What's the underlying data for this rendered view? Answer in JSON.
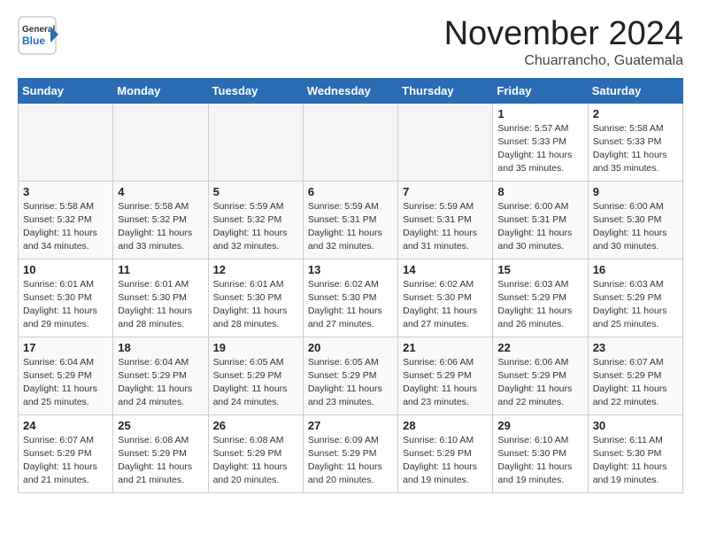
{
  "header": {
    "logo_line1": "General",
    "logo_line2": "Blue",
    "month_title": "November 2024",
    "location": "Chuarrancho, Guatemala"
  },
  "weekdays": [
    "Sunday",
    "Monday",
    "Tuesday",
    "Wednesday",
    "Thursday",
    "Friday",
    "Saturday"
  ],
  "weeks": [
    [
      {
        "day": "",
        "info": ""
      },
      {
        "day": "",
        "info": ""
      },
      {
        "day": "",
        "info": ""
      },
      {
        "day": "",
        "info": ""
      },
      {
        "day": "",
        "info": ""
      },
      {
        "day": "1",
        "info": "Sunrise: 5:57 AM\nSunset: 5:33 PM\nDaylight: 11 hours\nand 35 minutes."
      },
      {
        "day": "2",
        "info": "Sunrise: 5:58 AM\nSunset: 5:33 PM\nDaylight: 11 hours\nand 35 minutes."
      }
    ],
    [
      {
        "day": "3",
        "info": "Sunrise: 5:58 AM\nSunset: 5:32 PM\nDaylight: 11 hours\nand 34 minutes."
      },
      {
        "day": "4",
        "info": "Sunrise: 5:58 AM\nSunset: 5:32 PM\nDaylight: 11 hours\nand 33 minutes."
      },
      {
        "day": "5",
        "info": "Sunrise: 5:59 AM\nSunset: 5:32 PM\nDaylight: 11 hours\nand 32 minutes."
      },
      {
        "day": "6",
        "info": "Sunrise: 5:59 AM\nSunset: 5:31 PM\nDaylight: 11 hours\nand 32 minutes."
      },
      {
        "day": "7",
        "info": "Sunrise: 5:59 AM\nSunset: 5:31 PM\nDaylight: 11 hours\nand 31 minutes."
      },
      {
        "day": "8",
        "info": "Sunrise: 6:00 AM\nSunset: 5:31 PM\nDaylight: 11 hours\nand 30 minutes."
      },
      {
        "day": "9",
        "info": "Sunrise: 6:00 AM\nSunset: 5:30 PM\nDaylight: 11 hours\nand 30 minutes."
      }
    ],
    [
      {
        "day": "10",
        "info": "Sunrise: 6:01 AM\nSunset: 5:30 PM\nDaylight: 11 hours\nand 29 minutes."
      },
      {
        "day": "11",
        "info": "Sunrise: 6:01 AM\nSunset: 5:30 PM\nDaylight: 11 hours\nand 28 minutes."
      },
      {
        "day": "12",
        "info": "Sunrise: 6:01 AM\nSunset: 5:30 PM\nDaylight: 11 hours\nand 28 minutes."
      },
      {
        "day": "13",
        "info": "Sunrise: 6:02 AM\nSunset: 5:30 PM\nDaylight: 11 hours\nand 27 minutes."
      },
      {
        "day": "14",
        "info": "Sunrise: 6:02 AM\nSunset: 5:30 PM\nDaylight: 11 hours\nand 27 minutes."
      },
      {
        "day": "15",
        "info": "Sunrise: 6:03 AM\nSunset: 5:29 PM\nDaylight: 11 hours\nand 26 minutes."
      },
      {
        "day": "16",
        "info": "Sunrise: 6:03 AM\nSunset: 5:29 PM\nDaylight: 11 hours\nand 25 minutes."
      }
    ],
    [
      {
        "day": "17",
        "info": "Sunrise: 6:04 AM\nSunset: 5:29 PM\nDaylight: 11 hours\nand 25 minutes."
      },
      {
        "day": "18",
        "info": "Sunrise: 6:04 AM\nSunset: 5:29 PM\nDaylight: 11 hours\nand 24 minutes."
      },
      {
        "day": "19",
        "info": "Sunrise: 6:05 AM\nSunset: 5:29 PM\nDaylight: 11 hours\nand 24 minutes."
      },
      {
        "day": "20",
        "info": "Sunrise: 6:05 AM\nSunset: 5:29 PM\nDaylight: 11 hours\nand 23 minutes."
      },
      {
        "day": "21",
        "info": "Sunrise: 6:06 AM\nSunset: 5:29 PM\nDaylight: 11 hours\nand 23 minutes."
      },
      {
        "day": "22",
        "info": "Sunrise: 6:06 AM\nSunset: 5:29 PM\nDaylight: 11 hours\nand 22 minutes."
      },
      {
        "day": "23",
        "info": "Sunrise: 6:07 AM\nSunset: 5:29 PM\nDaylight: 11 hours\nand 22 minutes."
      }
    ],
    [
      {
        "day": "24",
        "info": "Sunrise: 6:07 AM\nSunset: 5:29 PM\nDaylight: 11 hours\nand 21 minutes."
      },
      {
        "day": "25",
        "info": "Sunrise: 6:08 AM\nSunset: 5:29 PM\nDaylight: 11 hours\nand 21 minutes."
      },
      {
        "day": "26",
        "info": "Sunrise: 6:08 AM\nSunset: 5:29 PM\nDaylight: 11 hours\nand 20 minutes."
      },
      {
        "day": "27",
        "info": "Sunrise: 6:09 AM\nSunset: 5:29 PM\nDaylight: 11 hours\nand 20 minutes."
      },
      {
        "day": "28",
        "info": "Sunrise: 6:10 AM\nSunset: 5:29 PM\nDaylight: 11 hours\nand 19 minutes."
      },
      {
        "day": "29",
        "info": "Sunrise: 6:10 AM\nSunset: 5:30 PM\nDaylight: 11 hours\nand 19 minutes."
      },
      {
        "day": "30",
        "info": "Sunrise: 6:11 AM\nSunset: 5:30 PM\nDaylight: 11 hours\nand 19 minutes."
      }
    ]
  ]
}
